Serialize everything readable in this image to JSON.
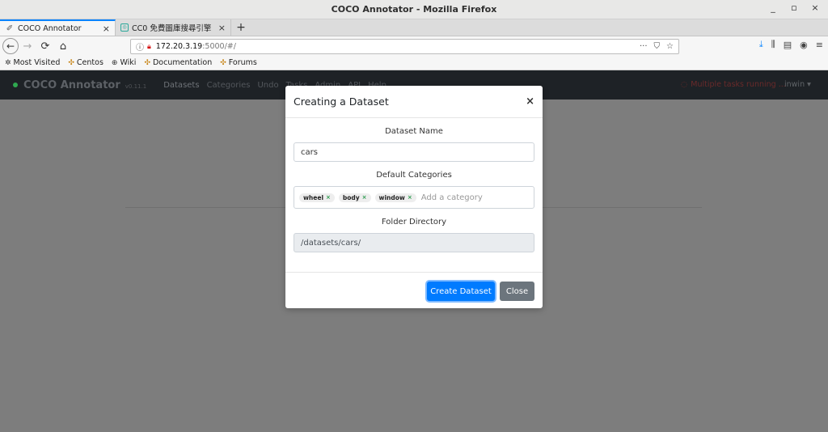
{
  "window": {
    "title": "COCO Annotator - Mozilla Firefox",
    "controls": [
      "_",
      "▫",
      "×"
    ]
  },
  "tabs": [
    {
      "label": "COCO Annotator",
      "close": "×"
    },
    {
      "label": "CC0 免費圖庫搜尋引擎",
      "close": "×"
    }
  ],
  "newtab": "+",
  "url": {
    "host": "172.20.3.19",
    "path": ":5000/#/",
    "more": "···"
  },
  "bookmarks": [
    "Most Visited",
    "Centos",
    "Wiki",
    "Documentation",
    "Forums"
  ],
  "app": {
    "brand": "COCO Annotator",
    "version": "v0.11.1",
    "menu": [
      "Datasets",
      "Categories",
      "Undo",
      "Tasks",
      "Admin",
      "API",
      "Help"
    ],
    "tasks_status": "Multiple tasks running ...",
    "user": "inwin"
  },
  "modal": {
    "title": "Creating a Dataset",
    "close": "×",
    "dataset_name_label": "Dataset Name",
    "dataset_name_value": "cars",
    "categories_label": "Default Categories",
    "categories": [
      "wheel",
      "body",
      "window"
    ],
    "tag_remove": "×",
    "category_placeholder": "Add a category",
    "folder_label": "Folder Directory",
    "folder_value": "/datasets/cars/",
    "create_button": "Create Dataset",
    "close_button": "Close"
  }
}
